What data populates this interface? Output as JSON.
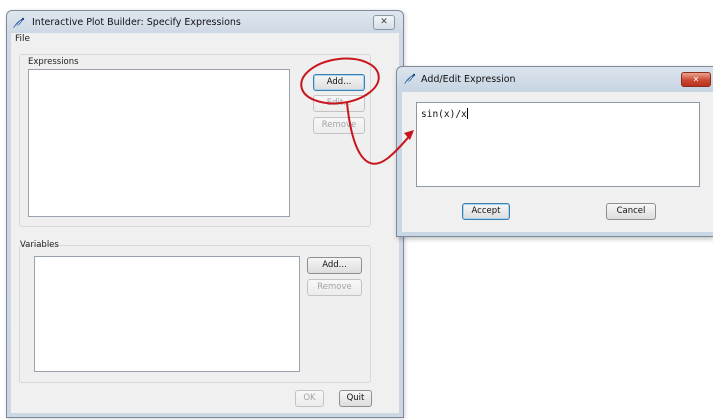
{
  "main_window": {
    "title": "Interactive Plot Builder: Specify Expressions",
    "close_glyph": "✕",
    "menu": {
      "file_label": "File"
    },
    "expressions_group": {
      "label": "Expressions",
      "add_label": "Add...",
      "edit_label": "Edit...",
      "remove_label": "Remove"
    },
    "variables_group": {
      "label": "Variables",
      "add_label": "Add...",
      "remove_label": "Remove"
    },
    "ok_label": "OK",
    "quit_label": "Quit"
  },
  "dialog": {
    "title": "Add/Edit Expression",
    "close_glyph": "✕",
    "expression_value": "sin(x)/x",
    "accept_label": "Accept",
    "cancel_label": "Cancel"
  },
  "colors": {
    "annotation_red": "#c8161d",
    "titlebar": "#dfe6ee",
    "dialog_close": "#cb4a33"
  },
  "icons": {
    "app": "python-feather-icon",
    "close": "close-icon"
  }
}
